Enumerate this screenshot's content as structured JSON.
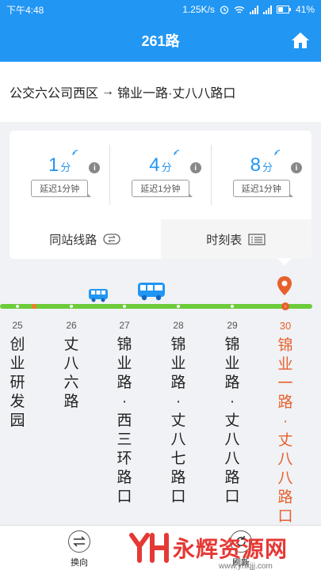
{
  "status_bar": {
    "time": "下午4:48",
    "network_speed": "1.25K/s",
    "battery": "41%"
  },
  "title_bar": {
    "title": "261路"
  },
  "route": {
    "from": "公交六公司西区",
    "arrow": "→",
    "to": "锦业一路·丈八八路口"
  },
  "arrivals": [
    {
      "value": "1",
      "unit": "分",
      "delay": "延迟1分钟"
    },
    {
      "value": "4",
      "unit": "分",
      "delay": "延迟1分钟"
    },
    {
      "value": "8",
      "unit": "分",
      "delay": "延迟1分钟"
    }
  ],
  "tabs": [
    {
      "label": "同站线路",
      "active": false
    },
    {
      "label": "时刻表",
      "active": true
    }
  ],
  "stations": [
    {
      "no": "25",
      "name": "创业研发园"
    },
    {
      "no": "26",
      "name": "丈八六路"
    },
    {
      "no": "27",
      "name": "锦业路·西三环路口"
    },
    {
      "no": "28",
      "name": "锦业路·丈八七路口"
    },
    {
      "no": "29",
      "name": "锦业路·丈八八路口"
    },
    {
      "no": "30",
      "name": "锦业一路·丈八八路口",
      "current": true
    }
  ],
  "bottom_bar": {
    "swap_label": "换向",
    "refresh_label": "刷新"
  },
  "watermark": {
    "text": "永辉资源网",
    "url": "www.yhkjjj.com"
  },
  "colors": {
    "primary": "#2196f3",
    "track": "#6ccc3a",
    "current_station": "#e8602c"
  }
}
